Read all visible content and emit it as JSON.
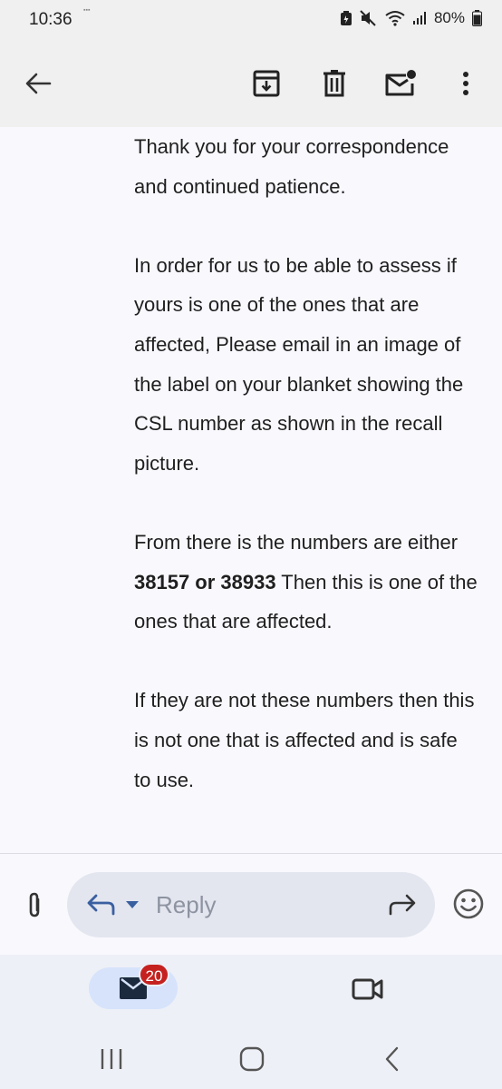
{
  "status_bar": {
    "time": "10:36",
    "battery": "80%"
  },
  "toolbar": {
    "back": "back-arrow-icon",
    "archive": "archive-icon",
    "delete": "delete-icon",
    "mark_unread": "mark-unread-icon",
    "more": "more-vert-icon"
  },
  "email": {
    "para1": "Thank you for your correspondence and continued patience.",
    "para2": "In order for us to be able to assess if yours is one of the ones that are affected, Please email in an image of the label on your blanket showing the CSL number as shown in the recall picture.",
    "para3_pre": "From there is the numbers are either ",
    "para3_bold": "38157 or 38933",
    "para3_post": " Then this is one of the ones that are affected.",
    "para4": "If they are not these numbers then this is not one that is affected and is safe to use."
  },
  "reply_bar": {
    "label": "Reply"
  },
  "bottom_nav": {
    "mail_badge": "20"
  },
  "colors": {
    "accent": "#d6e3fb",
    "badge": "#c5221f",
    "background": "#f8f8fd"
  }
}
